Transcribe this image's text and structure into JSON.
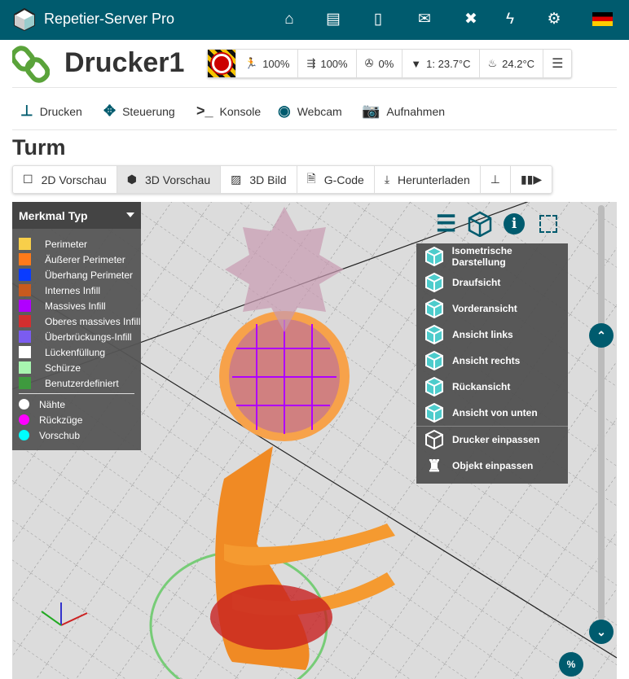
{
  "header": {
    "app_title": "Repetier-Server Pro",
    "icons": [
      "home-icon",
      "archive-icon",
      "printer-icon",
      "mail-icon",
      "expand-icon",
      "bolt-icon",
      "gear-icon",
      "flag-de-icon"
    ]
  },
  "printer": {
    "name": "Drucker1"
  },
  "status": {
    "speed": "100%",
    "flow": "100%",
    "fan": "0%",
    "extruder": "1: 23.7°C",
    "bed": "24.2°C"
  },
  "nav": [
    "Drucken",
    "Steuerung",
    "Konsole",
    "Webcam",
    "Aufnahmen"
  ],
  "section_title": "Turm",
  "tabs": [
    "2D Vorschau",
    "3D Vorschau",
    "3D Bild",
    "G-Code",
    "Herunterladen"
  ],
  "legend": {
    "title": "Merkmal Typ",
    "items": [
      {
        "label": "Perimeter",
        "color": "#f8cf4a"
      },
      {
        "label": "Äußerer Perimeter",
        "color": "#ff7a1a"
      },
      {
        "label": "Überhang Perimeter",
        "color": "#0a3cff"
      },
      {
        "label": "Internes Infill",
        "color": "#c85a1e"
      },
      {
        "label": "Massives Infill",
        "color": "#b000ff"
      },
      {
        "label": "Oberes massives Infill",
        "color": "#d32f2f"
      },
      {
        "label": "Überbrückungs-Infill",
        "color": "#7b5cf0"
      },
      {
        "label": "Lückenfüllung",
        "color": "#ffffff"
      },
      {
        "label": "Schürze",
        "color": "#a8f5b0"
      },
      {
        "label": "Benutzerdefiniert",
        "color": "#3e9a3e"
      }
    ],
    "markers": [
      {
        "label": "Nähte",
        "color": "#ffffff"
      },
      {
        "label": "Rückzüge",
        "color": "#ff00ff"
      },
      {
        "label": "Vorschub",
        "color": "#00ffff"
      }
    ]
  },
  "view_menu": [
    "Isometrische Darstellung",
    "Draufsicht",
    "Vorderansicht",
    "Ansicht links",
    "Ansicht rechts",
    "Rückansicht",
    "Ansicht von unten",
    "Drucker einpassen",
    "Objekt einpassen"
  ],
  "zoom_button": "%"
}
